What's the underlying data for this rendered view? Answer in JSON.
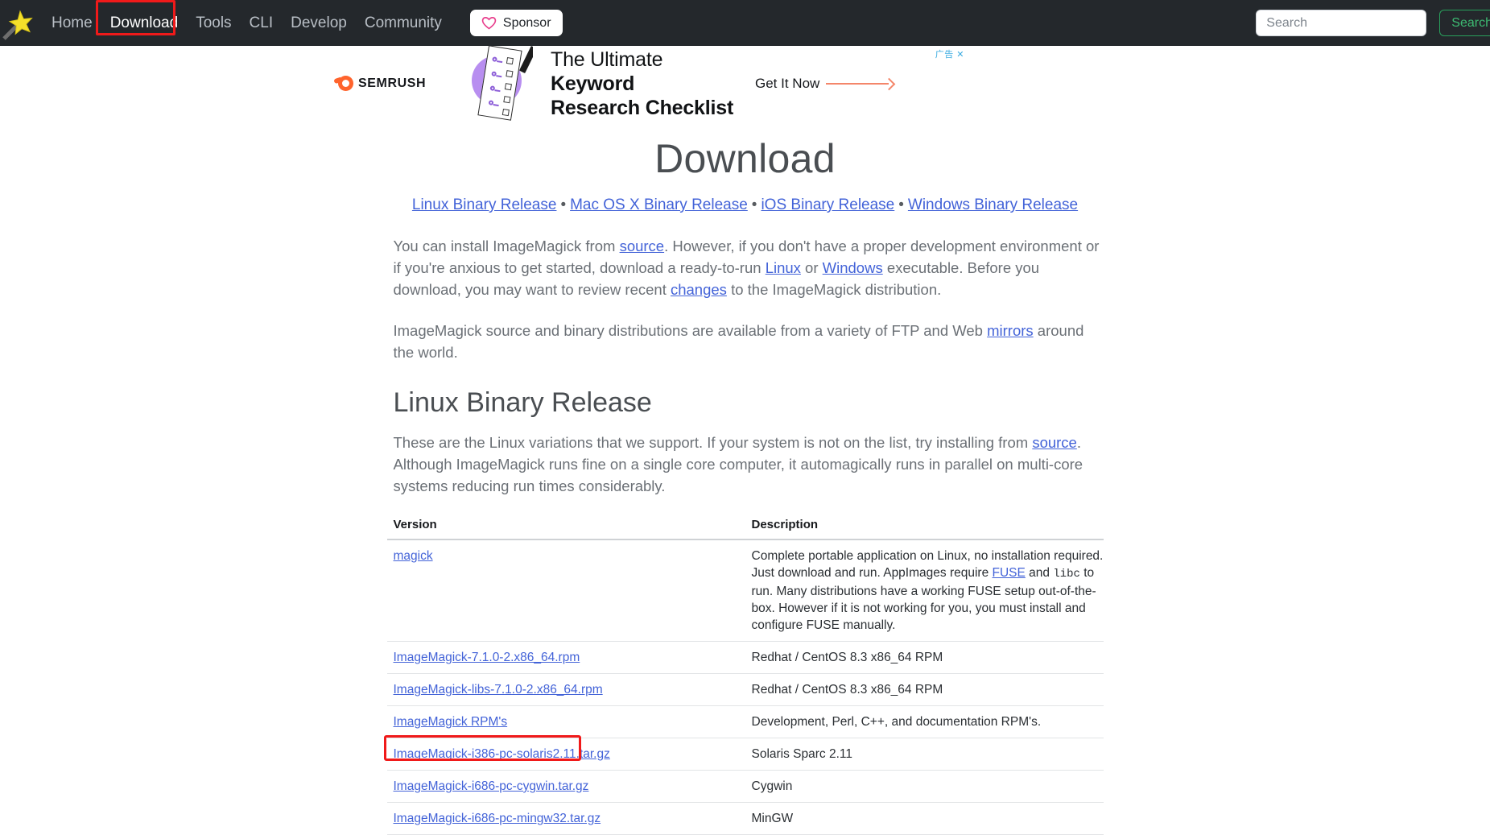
{
  "navbar": {
    "logo_icon": "magic-wand-star-icon",
    "links": [
      {
        "label": "Home",
        "active": false
      },
      {
        "label": "Download",
        "active": true
      },
      {
        "label": "Tools",
        "active": false
      },
      {
        "label": "CLI",
        "active": false
      },
      {
        "label": "Develop",
        "active": false
      },
      {
        "label": "Community",
        "active": false
      }
    ],
    "sponsor_label": "Sponsor",
    "sponsor_icon": "heart-icon",
    "search_placeholder": "Search",
    "search_value": "",
    "search_button_label": "Search",
    "highlight_color": "#f01a1a",
    "background_color": "#24282c"
  },
  "ad": {
    "label": "广告 ✕",
    "brand": "SEMRUSH",
    "headline_line1_light": "The Ultimate ",
    "headline_line1_bold": "Keyword",
    "headline_line2": "Research Checklist",
    "cta_label": "Get It Now",
    "accent_color": "#ff642d",
    "art_color": "#b88ef0"
  },
  "page": {
    "title": "Download",
    "binary_links": [
      "Linux Binary Release",
      "Mac OS X Binary Release",
      "iOS Binary Release",
      "Windows Binary Release"
    ],
    "bullet_separator": "•",
    "para_1": {
      "t1": "You can install ImageMagick from ",
      "l1": "source",
      "t2": ". However, if you don't have a proper development environment or if you're anxious to get started, download a ready-to-run ",
      "l2": "Linux",
      "t3": " or ",
      "l3": "Windows",
      "t4": " executable. Before you download, you may want to review recent ",
      "l4": "changes",
      "t5": " to the ImageMagick distribution."
    },
    "para_2": {
      "t1": "ImageMagick source and binary distributions are available from a variety of FTP and Web ",
      "l1": "mirrors",
      "t2": " around the world."
    },
    "section_title": "Linux Binary Release",
    "para_3": {
      "t1": "These are the Linux variations that we support. If your system is not on the list, try installing from ",
      "l1": "source",
      "t2": ". Although ImageMagick runs fine on a single core computer, it automagically runs in parallel on multi-core systems reducing run times considerably."
    }
  },
  "table": {
    "headers": [
      "Version",
      "Description"
    ],
    "rows": [
      {
        "version": "magick",
        "description_parts": {
          "t1": "Complete portable application on Linux, no installation required. Just download and run. AppImages require ",
          "l1": "FUSE",
          "t2": " and ",
          "code1": "libc",
          "t3": " to run. Many distributions have a working FUSE setup out-of-the-box. However if it is not working for you, you must install and configure FUSE manually."
        },
        "highlighted": false
      },
      {
        "version": "ImageMagick-7.1.0-2.x86_64.rpm",
        "description": "Redhat / CentOS 8.3 x86_64 RPM",
        "highlighted": false
      },
      {
        "version": "ImageMagick-libs-7.1.0-2.x86_64.rpm",
        "description": "Redhat / CentOS 8.3 x86_64 RPM",
        "highlighted": false
      },
      {
        "version": "ImageMagick RPM's",
        "description": "Development, Perl, C++, and documentation RPM's.",
        "highlighted": false
      },
      {
        "version": "ImageMagick-i386-pc-solaris2.11.tar.gz",
        "description": "Solaris Sparc 2.11",
        "highlighted": true
      },
      {
        "version": "ImageMagick-i686-pc-cygwin.tar.gz",
        "description": "Cygwin",
        "highlighted": false
      },
      {
        "version": "ImageMagick-i686-pc-mingw32.tar.gz",
        "description": "MinGW",
        "highlighted": false
      }
    ]
  }
}
